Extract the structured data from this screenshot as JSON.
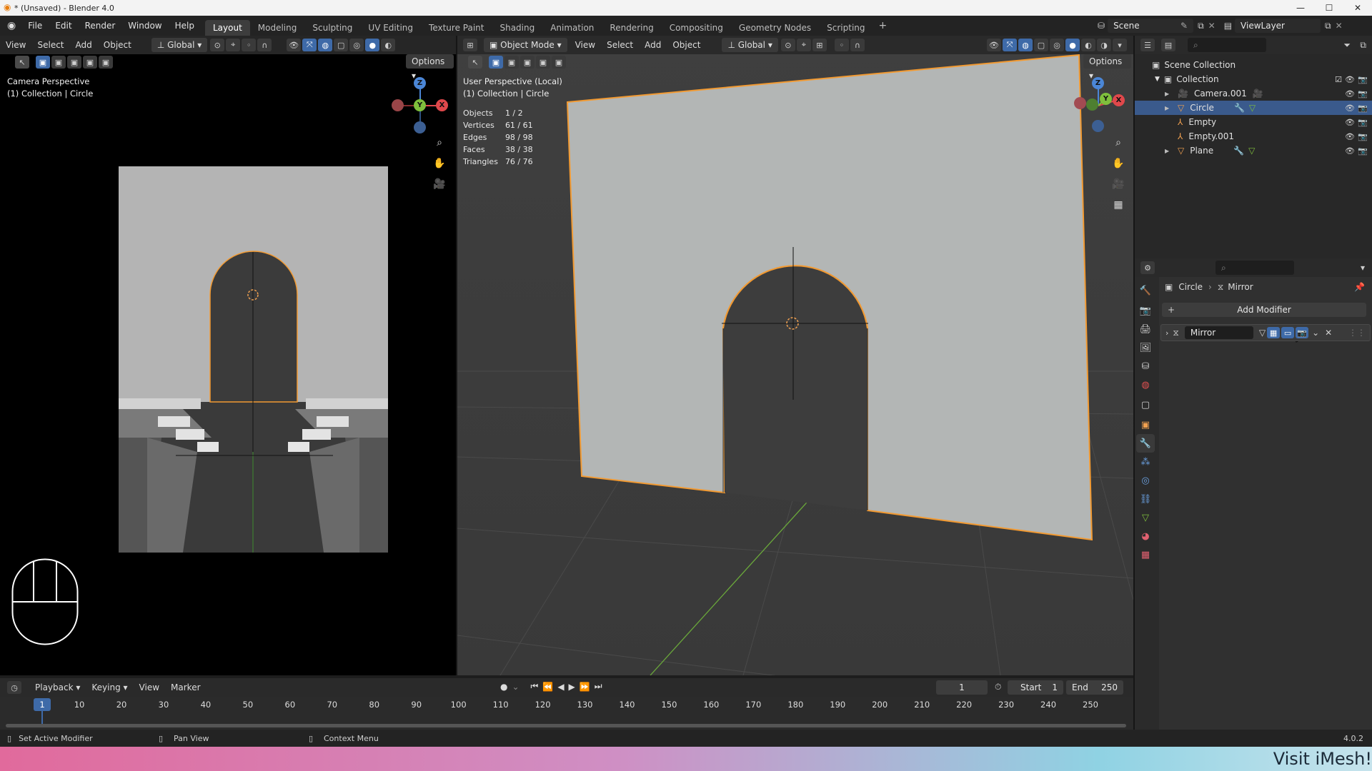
{
  "window": {
    "title": "* (Unsaved) - Blender 4.0"
  },
  "menus": [
    "File",
    "Edit",
    "Render",
    "Window",
    "Help"
  ],
  "workspaces": [
    "Layout",
    "Modeling",
    "Sculpting",
    "UV Editing",
    "Texture Paint",
    "Shading",
    "Animation",
    "Rendering",
    "Compositing",
    "Geometry Nodes",
    "Scripting"
  ],
  "active_workspace": "Layout",
  "scene": {
    "name": "Scene",
    "view_layer": "ViewLayer"
  },
  "left_viewport": {
    "menus": [
      "View",
      "Select",
      "Add",
      "Object"
    ],
    "transform": "Global",
    "options": "Options",
    "label1": "Camera Perspective",
    "label2": "(1) Collection | Circle"
  },
  "main_viewport": {
    "mode": "Object Mode",
    "menus": [
      "View",
      "Select",
      "Add",
      "Object"
    ],
    "transform": "Global",
    "options": "Options",
    "label1": "User Perspective (Local)",
    "label2": "(1) Collection | Circle",
    "stats": [
      {
        "k": "Objects",
        "v": "1 / 2"
      },
      {
        "k": "Vertices",
        "v": "61 / 61"
      },
      {
        "k": "Edges",
        "v": "98 / 98"
      },
      {
        "k": "Faces",
        "v": "38 / 38"
      },
      {
        "k": "Triangles",
        "v": "76 / 76"
      }
    ]
  },
  "gizmo": {
    "z": "Z",
    "y": "Y",
    "x": "X"
  },
  "outliner": {
    "root": "Scene Collection",
    "collection": "Collection",
    "items": [
      {
        "name": "Camera.001",
        "icon": "camera-icon",
        "selected": false
      },
      {
        "name": "Circle",
        "icon": "mesh-icon",
        "selected": true
      },
      {
        "name": "Empty",
        "icon": "empty-icon",
        "selected": false
      },
      {
        "name": "Empty.001",
        "icon": "empty-icon",
        "selected": false
      },
      {
        "name": "Plane",
        "icon": "mesh-icon",
        "selected": false
      }
    ]
  },
  "properties": {
    "breadcrumb_object": "Circle",
    "breadcrumb_modifier": "Mirror",
    "add_modifier": "Add Modifier",
    "modifier_name": "Mirror"
  },
  "timeline": {
    "menus": [
      "Playback",
      "Keying",
      "View",
      "Marker"
    ],
    "current_frame": "1",
    "start_label": "Start",
    "start": "1",
    "end_label": "End",
    "end": "250",
    "ticks": [
      "1",
      "10",
      "20",
      "30",
      "40",
      "50",
      "60",
      "70",
      "80",
      "90",
      "100",
      "110",
      "120",
      "130",
      "140",
      "150",
      "160",
      "170",
      "180",
      "190",
      "200",
      "210",
      "220",
      "230",
      "240",
      "250"
    ]
  },
  "status": {
    "left": "Set Active Modifier",
    "middle": "Pan View",
    "right": "Context Menu",
    "version": "4.0.2"
  },
  "banner": "Visit iMesh!",
  "colors": {
    "accent": "#3e6aa8",
    "selection_outline": "#f29a32",
    "x_axis": "#e0484b",
    "y_axis": "#7fbf3c",
    "z_axis": "#4b86d6"
  }
}
